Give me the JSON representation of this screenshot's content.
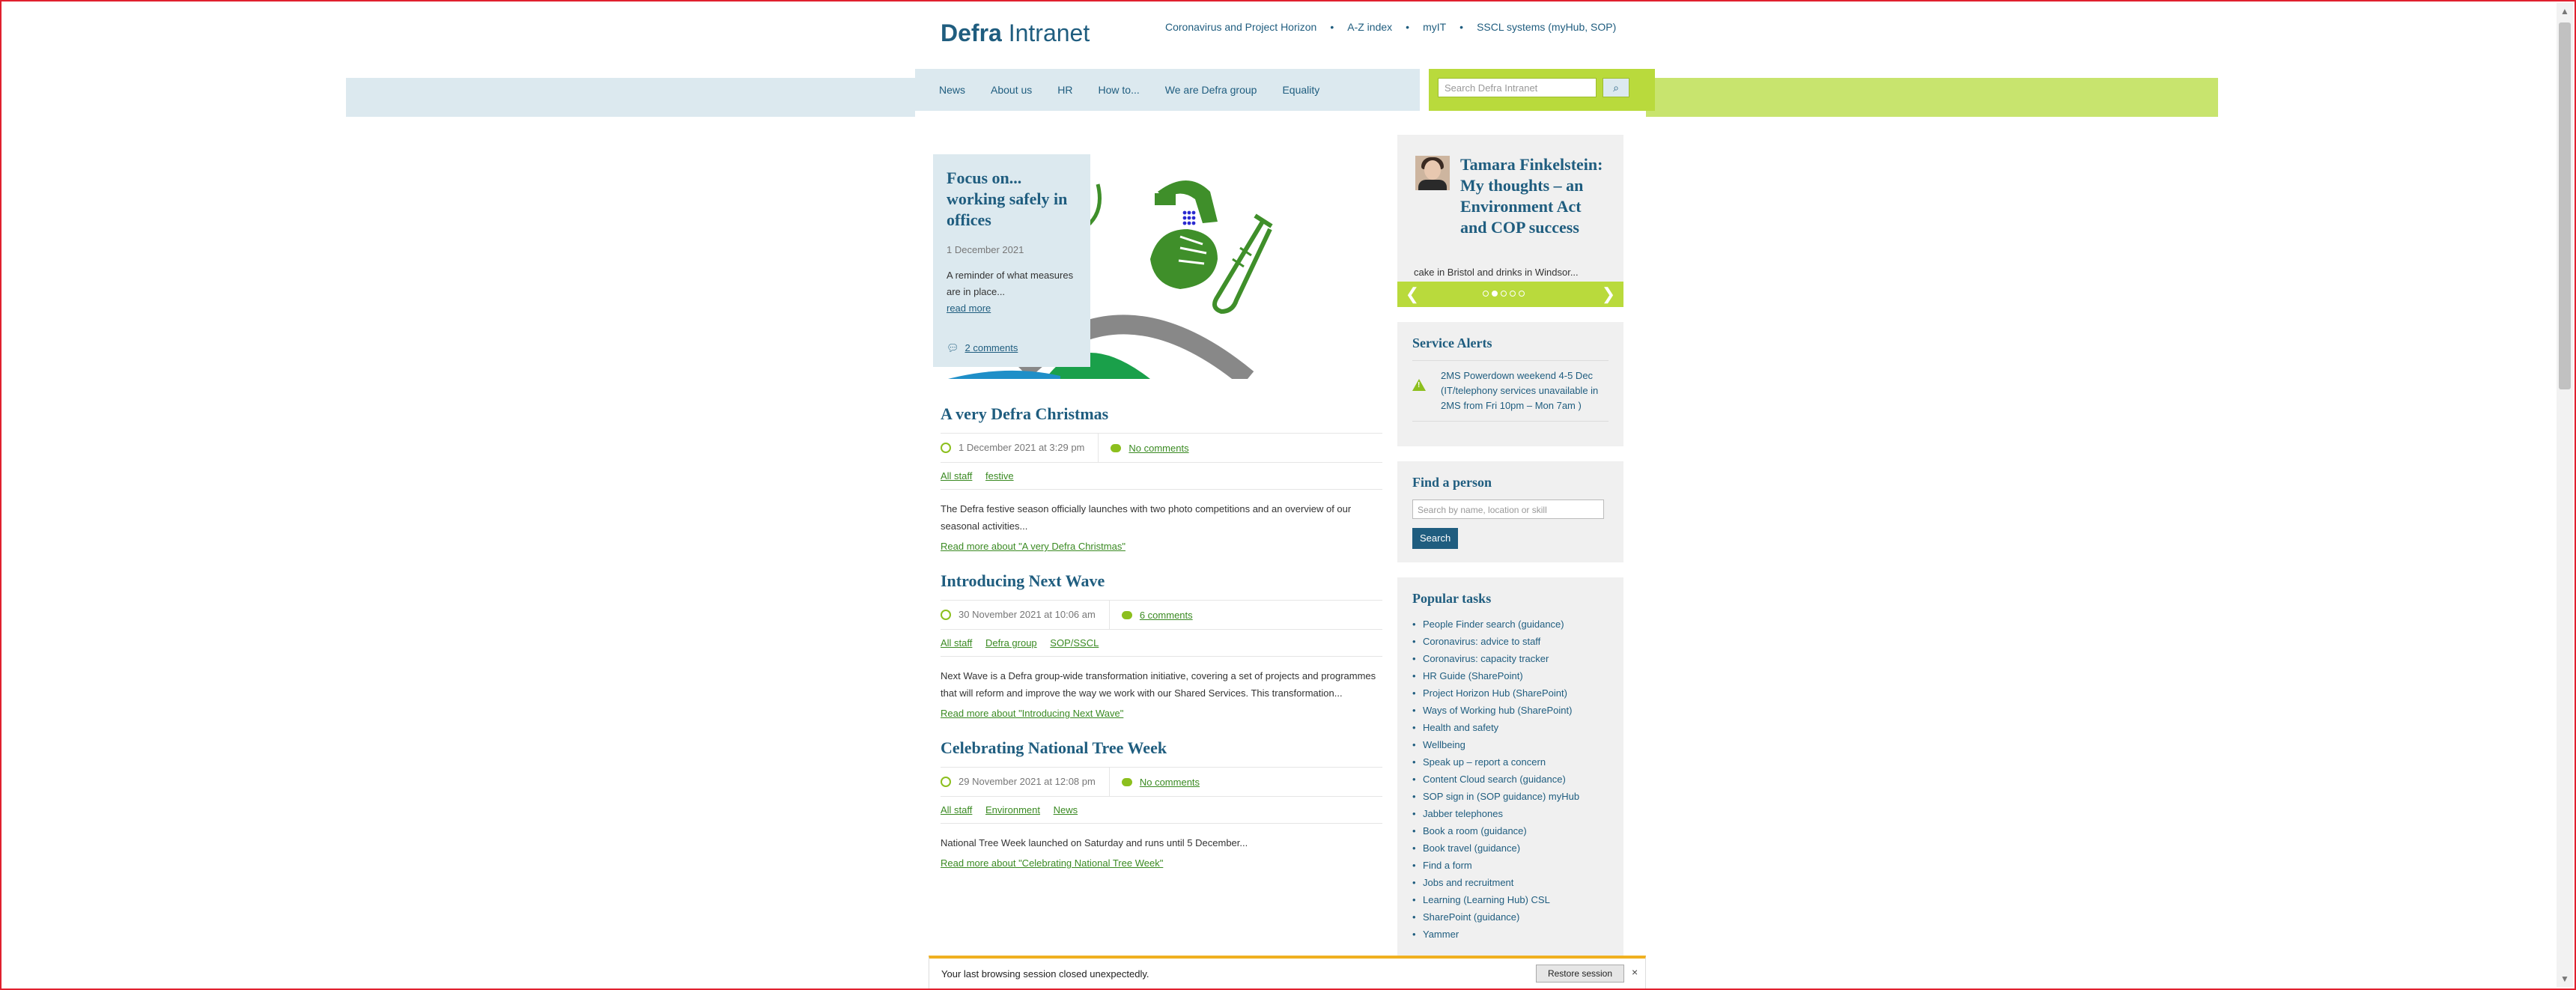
{
  "site": {
    "logo_bold": "Defra",
    "logo_rest": " Intranet"
  },
  "toplinks": [
    "Coronavirus and Project Horizon",
    "A-Z index",
    "myIT",
    "SSCL systems (myHub, SOP)"
  ],
  "nav": [
    "News",
    "About us",
    "HR",
    "How to...",
    "We are Defra group",
    "Equality"
  ],
  "search": {
    "placeholder": "Search Defra Intranet"
  },
  "feature": {
    "title": "Focus on... working safely in offices",
    "date": "1 December 2021",
    "text": "A reminder of what measures are in place...",
    "read_more": "read more",
    "comments": "2 comments"
  },
  "articles": [
    {
      "title": "A very Defra Christmas",
      "date": "1 December 2021 at 3:29 pm",
      "comments": "No comments",
      "tags": [
        "All staff",
        "festive"
      ],
      "excerpt": "The Defra festive season officially launches with two photo competitions and an overview of our seasonal activities...",
      "read_more": "Read more about \"A very Defra Christmas\""
    },
    {
      "title": "Introducing Next Wave",
      "date": "30 November 2021 at 10:06 am",
      "comments": "6 comments",
      "tags": [
        "All staff",
        "Defra group",
        "SOP/SSCL"
      ],
      "excerpt": "Next Wave is a Defra group-wide transformation initiative, covering a set of projects and programmes that will reform and improve the way we work with our Shared Services. This transformation...",
      "read_more": "Read more about \"Introducing Next Wave\""
    },
    {
      "title": "Celebrating National Tree Week",
      "date": "29 November 2021 at 12:08 pm",
      "comments": "No comments",
      "tags": [
        "All staff",
        "Environment",
        "News"
      ],
      "excerpt": "National Tree Week launched on Saturday and runs until 5 December...",
      "read_more": "Read more about \"Celebrating National Tree Week\""
    }
  ],
  "blog": {
    "title": "Tamara Finkelstein: My thoughts – an Environment Act and COP success",
    "snippet": "cake in Bristol and drinks in Windsor..."
  },
  "alerts": {
    "heading": "Service Alerts",
    "item": "2MS Powerdown weekend 4-5 Dec (IT/telephony services unavailable in 2MS from Fri 10pm – Mon 7am )"
  },
  "find_person": {
    "heading": "Find a person",
    "placeholder": "Search by name, location or skill",
    "button": "Search"
  },
  "popular": {
    "heading": "Popular tasks",
    "items": [
      "People Finder search (guidance)",
      "Coronavirus: advice to staff",
      "Coronavirus: capacity tracker",
      "HR Guide (SharePoint)",
      "Project Horizon Hub (SharePoint)",
      "Ways of Working hub (SharePoint)",
      "Health and safety",
      "Wellbeing",
      "Speak up – report a concern",
      "Content Cloud search (guidance)",
      "SOP sign in (SOP guidance) myHub",
      "Jabber telephones",
      "Book a room (guidance)",
      "Book travel (guidance)",
      "Find a form",
      "Jobs and recruitment",
      "Learning (Learning Hub) CSL",
      "SharePoint (guidance)",
      "Yammer"
    ]
  },
  "restore": {
    "message": "Your last browsing session closed unexpectedly.",
    "button": "Restore session",
    "close": "×"
  }
}
